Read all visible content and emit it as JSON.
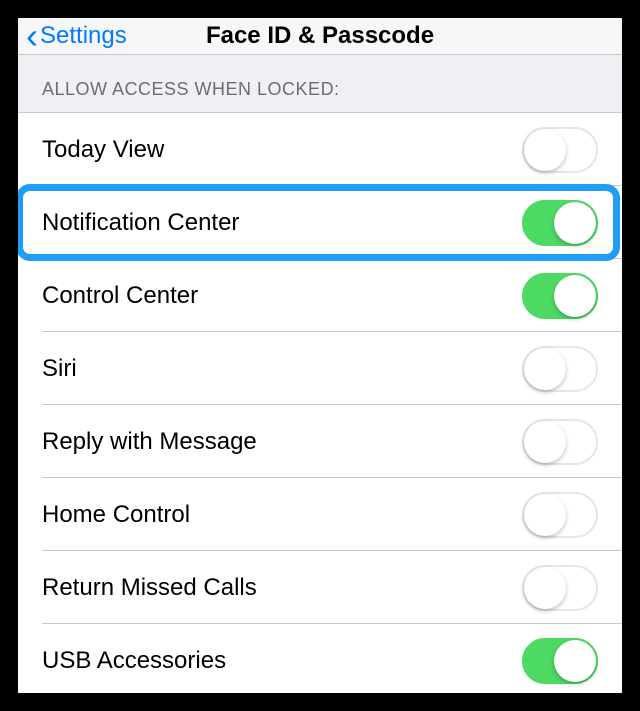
{
  "nav": {
    "back_label": "Settings",
    "title": "Face ID & Passcode"
  },
  "section": {
    "header": "ALLOW ACCESS WHEN LOCKED:"
  },
  "rows": [
    {
      "label": "Today View",
      "on": false,
      "highlighted": false
    },
    {
      "label": "Notification Center",
      "on": true,
      "highlighted": true
    },
    {
      "label": "Control Center",
      "on": true,
      "highlighted": false
    },
    {
      "label": "Siri",
      "on": false,
      "highlighted": false
    },
    {
      "label": "Reply with Message",
      "on": false,
      "highlighted": false
    },
    {
      "label": "Home Control",
      "on": false,
      "highlighted": false
    },
    {
      "label": "Return Missed Calls",
      "on": false,
      "highlighted": false
    },
    {
      "label": "USB Accessories",
      "on": true,
      "highlighted": false
    }
  ]
}
